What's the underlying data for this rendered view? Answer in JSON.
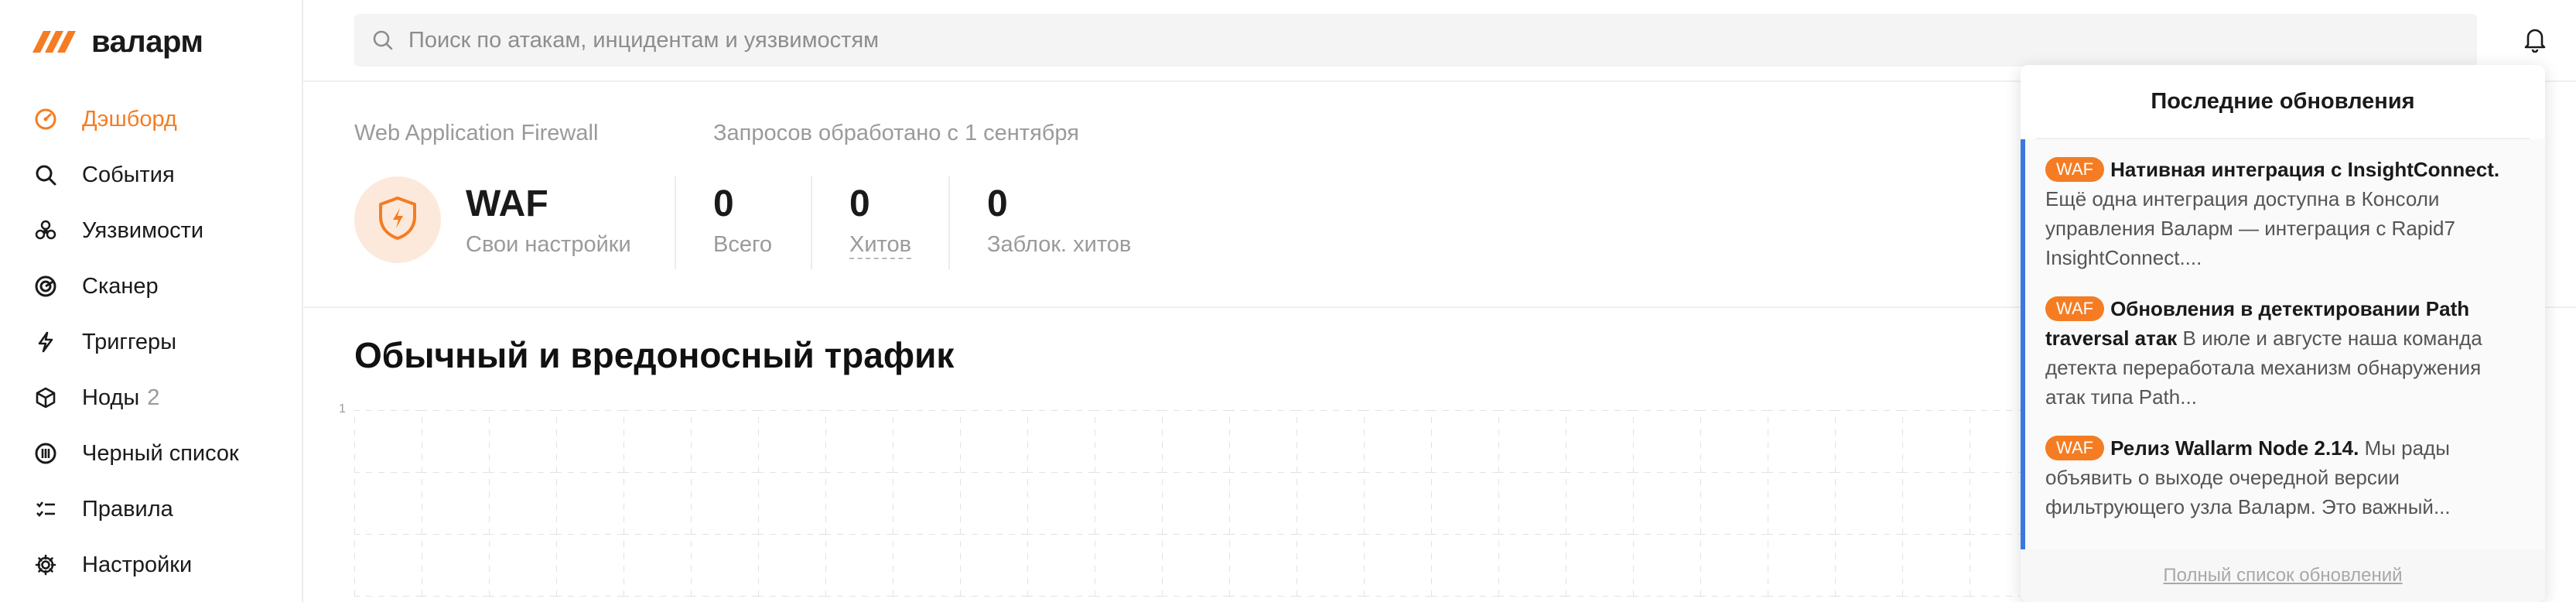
{
  "brand": {
    "name": "валарм",
    "accent": "#f57c22"
  },
  "search": {
    "placeholder": "Поиск по атакам, инцидентам и уязвимостям"
  },
  "sidebar": {
    "items": [
      {
        "label": "Дэшборд",
        "icon": "dashboard-icon",
        "active": true
      },
      {
        "label": "События",
        "icon": "search-icon"
      },
      {
        "label": "Уязвимости",
        "icon": "biohazard-icon"
      },
      {
        "label": "Сканер",
        "icon": "radar-icon"
      },
      {
        "label": "Триггеры",
        "icon": "lightning-icon"
      },
      {
        "label": "Ноды",
        "icon": "node-icon",
        "count": "2"
      },
      {
        "label": "Черный список",
        "icon": "blacklist-icon"
      },
      {
        "label": "Правила",
        "icon": "rules-icon"
      },
      {
        "label": "Настройки",
        "icon": "gear-icon"
      }
    ]
  },
  "waf": {
    "section_label": "Web Application Firewall",
    "requests_label": "Запросов обработано с 1 сентября",
    "title": "WAF",
    "subtitle": "Свои настройки",
    "stats": [
      {
        "value": "0",
        "label": "Всего"
      },
      {
        "value": "0",
        "label": "Хитов"
      },
      {
        "value": "0",
        "label": "Заблок. хитов"
      }
    ]
  },
  "traffic": {
    "title": "Обычный и вредоносный трафик",
    "axis_tick": "1"
  },
  "updates": {
    "title": "Последние обновления",
    "items": [
      {
        "tag": "WAF",
        "title": "Нативная интеграция с InsightConnect.",
        "text": "Ещё одна интеграция доступна в Консоли управления Валарм — интеграция с Rapid7 InsightConnect...."
      },
      {
        "tag": "WAF",
        "title": "Обновления в детектировании Path traversal атак",
        "text": "В июле и августе наша команда детекта переработала механизм обнаружения атак типа Path..."
      },
      {
        "tag": "WAF",
        "title": "Релиз Wallarm Node 2.14.",
        "text": "Мы рады объявить о выходе очередной версии фильтрующего узла Валарм. Это важный..."
      }
    ],
    "footer_link": "Полный список обновлений"
  }
}
